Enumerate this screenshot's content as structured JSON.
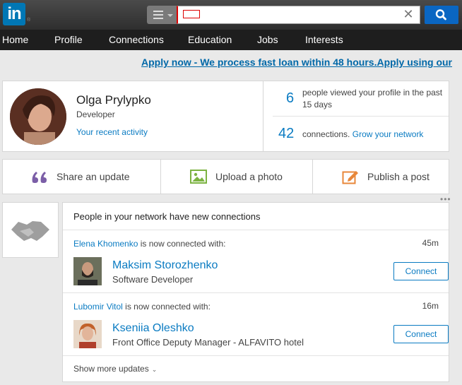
{
  "header": {
    "logo_text": "in",
    "logo_mark": "®",
    "search_value": "",
    "clear_glyph": "✕",
    "brand_color": "#0077b5"
  },
  "nav": {
    "items": [
      {
        "label": "Home"
      },
      {
        "label": "Profile"
      },
      {
        "label": "Connections"
      },
      {
        "label": "Education"
      },
      {
        "label": "Jobs"
      },
      {
        "label": "Interests"
      }
    ]
  },
  "ad": {
    "text": "Apply now - We process fast loan within 48 hours.Apply using our"
  },
  "profile": {
    "name": "Olga Prylypko",
    "title": "Developer",
    "activity_link": "Your recent activity",
    "views_count": "6",
    "views_text": "people viewed your profile in the past 15 days",
    "connections_count": "42",
    "connections_text": "connections.",
    "grow_link": "Grow your network"
  },
  "share": {
    "update_label": "Share an update",
    "photo_label": "Upload a photo",
    "post_label": "Publish a post",
    "update_icon": "quote-icon",
    "photo_icon": "image-icon",
    "post_icon": "edit-icon"
  },
  "feed": {
    "header": "People in your network have new connections",
    "items": [
      {
        "who": "Elena Khomenko",
        "suffix": "is now connected with:",
        "time": "45m",
        "name": "Maksim Storozhenko",
        "role": "Software Developer",
        "button": "Connect"
      },
      {
        "who": "Lubomir Vitol",
        "suffix": "is now connected with:",
        "time": "16m",
        "name": "Kseniia Oleshko",
        "role": "Front Office Deputy Manager - ALFAVITO hotel",
        "button": "Connect"
      }
    ],
    "show_more": "Show more updates",
    "more_dots": "•••"
  }
}
